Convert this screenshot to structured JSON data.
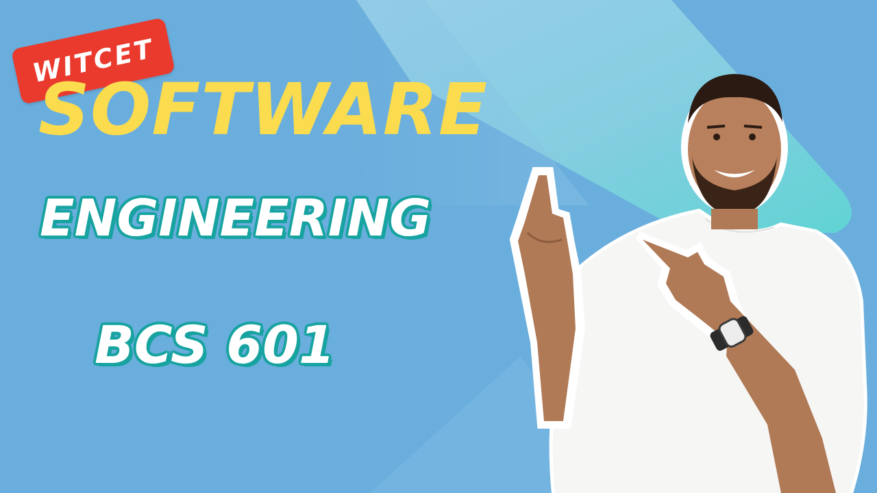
{
  "badge": {
    "label": "WITCET",
    "color": "#ea3a2e"
  },
  "title": {
    "line1": "SOFTWARE",
    "line2": "ENGINEERING",
    "line3": "BCS 601"
  },
  "colors": {
    "background": "#6aaedd",
    "title_yellow": "#fbdc4f",
    "outline_teal": "#17a3a0",
    "accent_teal": "#5fdad3"
  },
  "illustration": {
    "subject": "smiling-man-pointing-up"
  }
}
